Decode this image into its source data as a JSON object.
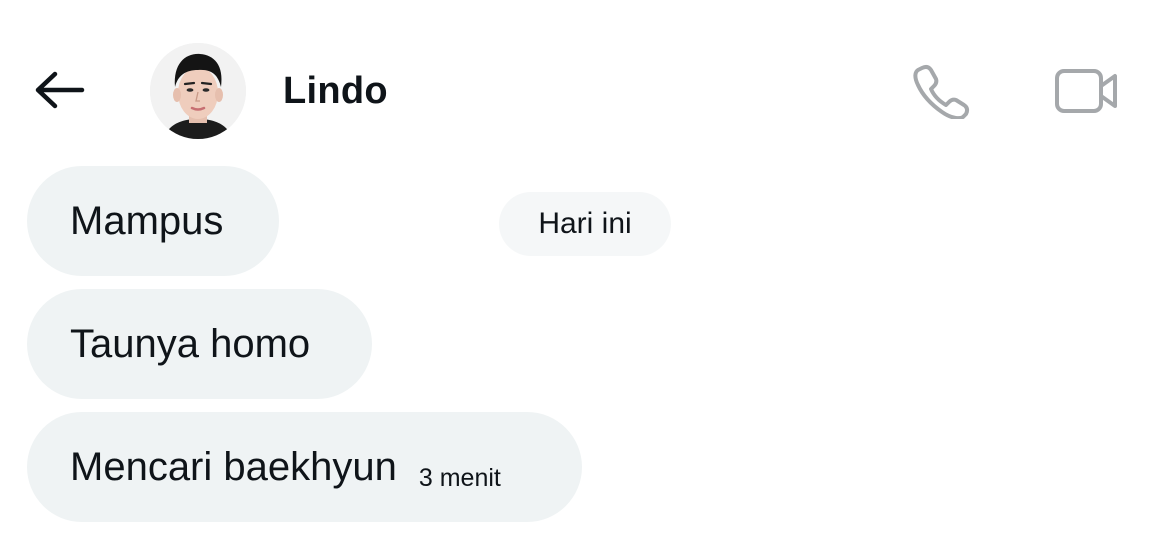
{
  "header": {
    "back_icon": "arrow-left-icon",
    "contact_name": "Lindo",
    "avatar_alt": "Lindo",
    "call_icon": "phone-icon",
    "video_icon": "video-camera-icon",
    "icon_color": "#a5a8ab"
  },
  "date_separator": "Hari ini",
  "messages": [
    {
      "text": "Mampus",
      "time": ""
    },
    {
      "text": "Taunya homo",
      "time": ""
    },
    {
      "text": "Mencari baekhyun",
      "time": "3 menit"
    }
  ],
  "colors": {
    "bubble_bg": "#eff3f4",
    "text": "#0f1419"
  }
}
